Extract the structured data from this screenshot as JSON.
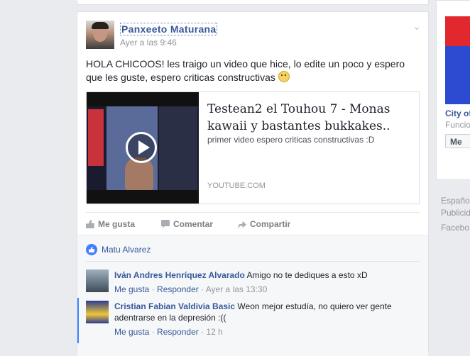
{
  "post": {
    "author": "Panxeeto Maturana",
    "time": "Ayer a las 9:46",
    "text": "HOLA CHICOOS! les traigo un video que hice, lo edite un poco y espero que les guste, espero criticas constructivas",
    "link": {
      "title": "Testean2 el Touhou 7 - Monas kawaii y bastantes bukkakes..",
      "description": "primer video espero criticas constructivas :D",
      "domain": "YOUTUBE.COM"
    },
    "actions": {
      "like": "Me gusta",
      "comment": "Comentar",
      "share": "Compartir"
    }
  },
  "likes": {
    "name": "Matu Alvarez"
  },
  "comments": [
    {
      "name": "Iván Andres Henríquez Alvarado",
      "text": "Amigo no te dediques a esto xD",
      "like": "Me gusta",
      "reply": "Responder",
      "time": "Ayer a las 13:30"
    },
    {
      "name": "Cristian Fabian Valdivia Basic",
      "text": "Weon mejor estudía, no quiero ver gente adentrarse en la depresión :((",
      "like": "Me gusta",
      "reply": "Responder",
      "time": "12 h"
    }
  ],
  "sidebar": {
    "link": "City of",
    "sub": "Funcio",
    "button": "Me"
  },
  "footer": {
    "line1": "Españo",
    "line2": "Publicid",
    "line3": "Facebo"
  },
  "colors": {
    "link": "#365899",
    "accent": "#4080ff",
    "background": "#e9ebee"
  }
}
